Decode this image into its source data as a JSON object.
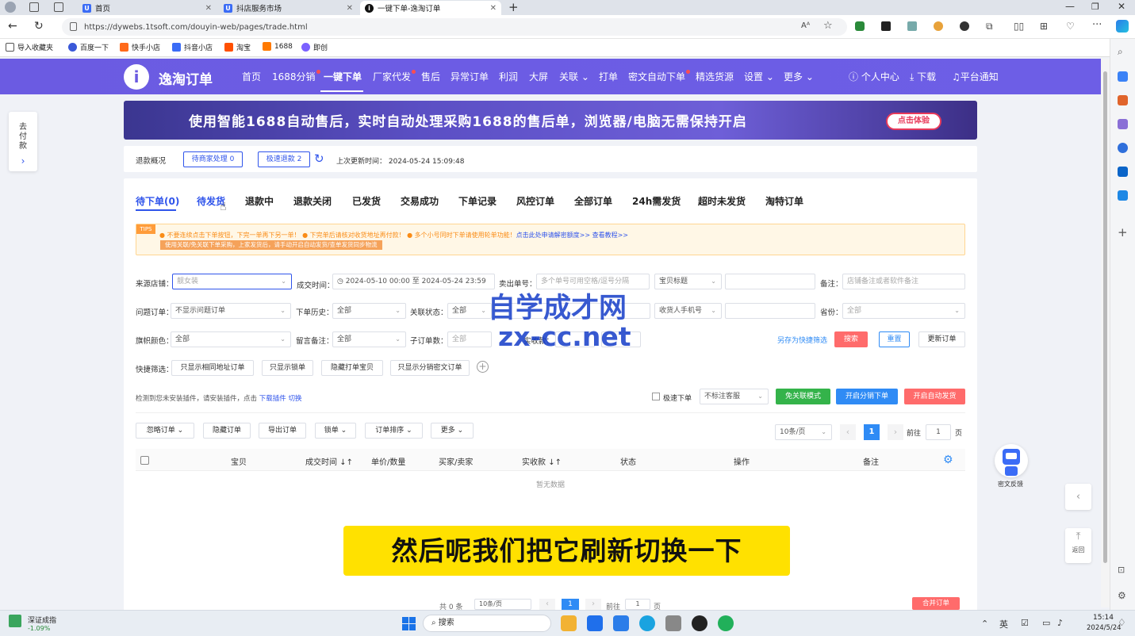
{
  "browser": {
    "tabs": [
      {
        "title": "首页"
      },
      {
        "title": "抖店服务市场"
      },
      {
        "title": "一键下单-逸淘订单"
      }
    ],
    "url": "https://dywebs.1tsoft.com/douyin-web/pages/trade.html",
    "bookmarks": [
      "导入收藏夹",
      "百度一下",
      "快手小店",
      "抖音小店",
      "淘宝",
      "1688",
      "即创"
    ]
  },
  "app": {
    "logo": "逸淘订单",
    "nav": [
      "首页",
      "1688分销",
      "一键下单",
      "厂家代发",
      "售后",
      "异常订单",
      "利润",
      "大屏",
      "关联",
      "打单",
      "密文自动下单",
      "精选货源",
      "设置",
      "更多"
    ],
    "nav_right": [
      "个人中心",
      "下载",
      "平台通知"
    ]
  },
  "banner": {
    "text": "使用智能1688自动售后，实时自动处理采购1688的售后单，浏览器/电脑无需保持开启",
    "button": "点击体验"
  },
  "left_float": "去付款",
  "refund": {
    "label": "退款概况",
    "pending_merchant": "待商家处理 0",
    "fast_refund": "极速退款 2",
    "update_label": "上次更新时间：",
    "update_time": "2024-05-24 15:09:48"
  },
  "order_tabs": [
    "待下单(0)",
    "待发货",
    "退款中",
    "退款关闭",
    "已发货",
    "交易成功",
    "下单记录",
    "风控订单",
    "全部订单",
    "24h需发货",
    "超时未发货",
    "淘特订单"
  ],
  "tips": {
    "tag": "TIPS",
    "line1": "● 不要连续点击下单按钮，下完一单再下另一单！ ● 下完单后请核对收货地址再付款！ ● 多个小号同时下单请使用轮单功能！",
    "link1": "点击此处申请解密额度>>",
    "link2": "查看教程>>",
    "line2": "使用关联/免关联下单采购，上家发货后，请手动开启自动发货/查单发货同步物流"
  },
  "filters": {
    "source_label": "来源店铺：",
    "source_value": "靓女装",
    "time_label": "成交时间：",
    "time_start": "2024-05-10 00:00",
    "time_to": "至",
    "time_end": "2024-05-24 23:59",
    "seller_no_label": "卖出单号：",
    "seller_no_ph": "多个单号可用空格/逗号分隔",
    "product_title": "宝贝标题",
    "remark_label": "备注：",
    "remark_ph": "店铺备注或者软件备注",
    "problem_label": "问题订单：",
    "problem_value": "不显示问题订单",
    "history_label": "下单历史：",
    "history_value": "全部",
    "assoc_label": "关联状态：",
    "assoc_value": "全部",
    "phone_value": "收货人手机号",
    "province_label": "省份：",
    "province_value": "全部",
    "flag_label": "旗帜颜色：",
    "flag_value": "全部",
    "msg_label": "留言备注：",
    "msg_value": "全部",
    "sub_label": "子订单数：",
    "sub_value": "全部",
    "paid_label": "实收款：",
    "save_filter": "另存为快捷筛选",
    "search": "搜索",
    "reset": "重置",
    "update": "更新订单"
  },
  "quick": {
    "label": "快捷筛选：",
    "items": [
      "只显示相同地址订单",
      "只显示锁单",
      "隐藏打单宝贝",
      "只显示分销密文订单"
    ]
  },
  "plugin": {
    "text": "检测到您未安装插件，请安装插件，点击",
    "link1": "下载插件",
    "link2": "切换"
  },
  "actions": {
    "fast_order": "极速下单",
    "flag_select": "不标注客服",
    "free_assoc": "免关联模式",
    "distribution": "开启分销下单",
    "auto_ship": "开启自动发货"
  },
  "toolbar": {
    "buttons": [
      "忽略订单",
      "隐藏订单",
      "导出订单",
      "锁单",
      "订单排序",
      "更多"
    ],
    "page_size": "10条/页",
    "page": "1",
    "goto": "前往",
    "goto_value": "1",
    "page_unit": "页"
  },
  "table": {
    "headers": [
      "宝贝",
      "成交时间",
      "单价/数量",
      "买家/卖家",
      "实收款",
      "状态",
      "操作",
      "备注"
    ],
    "empty": "暂无数据"
  },
  "bottom_pager": {
    "total": "共 0 条",
    "size": "10条/页",
    "page": "1",
    "goto": "前往",
    "goto_value": "1",
    "unit": "页",
    "merge": "合并订单"
  },
  "feedback": "密文反馈",
  "back": "返回",
  "watermark": {
    "line1": "自学成才网",
    "line2": "zx-cc.net"
  },
  "subtitle": "然后呢我们把它刷新切换一下",
  "taskbar": {
    "stock_name": "深证成指",
    "stock_change": "-1.09%",
    "search": "搜索",
    "time": "15:14",
    "date": "2024/5/24"
  },
  "colors": {
    "brand": "#6a5ae0",
    "link": "#2f54eb",
    "danger": "#ff6b6b",
    "green": "#34b34a",
    "blue": "#2f8bf5"
  }
}
